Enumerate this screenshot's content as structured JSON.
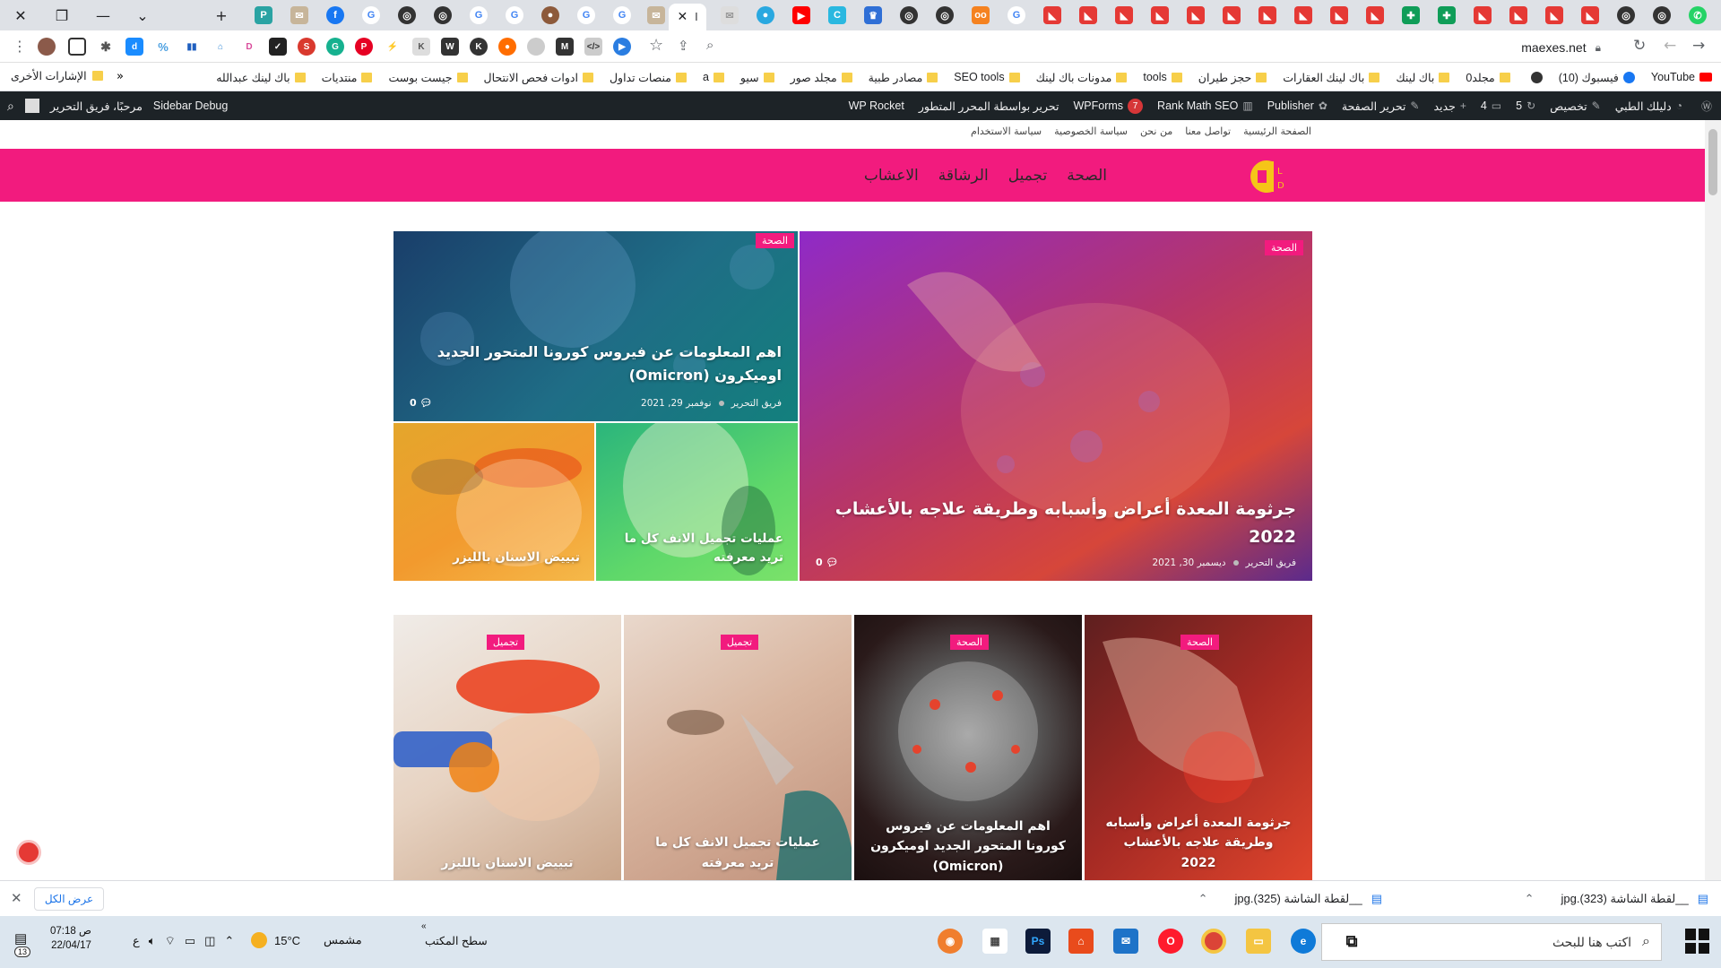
{
  "browser": {
    "address": "maexes.net",
    "active_tab_label": "ا",
    "bookmarks": [
      {
        "label": "YouTube",
        "icon": "youtube-icon"
      },
      {
        "label": "(10) فيسبوك",
        "icon": "facebook-icon"
      },
      {
        "label": "",
        "icon": "globe-icon"
      },
      {
        "label": "مجلد0",
        "icon": "folder-icon"
      },
      {
        "label": "باك لينك",
        "icon": "folder-icon"
      },
      {
        "label": "باك لينك العقارات",
        "icon": "folder-icon"
      },
      {
        "label": "حجز طيران",
        "icon": "folder-icon"
      },
      {
        "label": "tools",
        "icon": "folder-icon"
      },
      {
        "label": "مدونات باك لينك",
        "icon": "folder-icon"
      },
      {
        "label": "SEO tools",
        "icon": "folder-icon"
      },
      {
        "label": "مصادر طبية",
        "icon": "folder-icon"
      },
      {
        "label": "مجلد صور",
        "icon": "folder-icon"
      },
      {
        "label": "سيو",
        "icon": "folder-icon"
      },
      {
        "label": "a",
        "icon": "folder-icon"
      },
      {
        "label": "منصات تداول",
        "icon": "folder-icon"
      },
      {
        "label": "ادوات فحص الانتحال",
        "icon": "folder-icon"
      },
      {
        "label": "جيست بوست",
        "icon": "folder-icon"
      },
      {
        "label": "منتديات",
        "icon": "folder-icon"
      },
      {
        "label": "باك لينك عبدالله",
        "icon": "folder-icon"
      }
    ],
    "bookmarks_more": "»",
    "bookmarks_other": "الإشارات الأخرى"
  },
  "wpbar": {
    "right_items": [
      {
        "label": "",
        "icon": "wordpress-icon"
      },
      {
        "label": "دليلك الطبي",
        "icon": "dashboard-icon"
      },
      {
        "label": "تخصيص",
        "icon": "brush-icon"
      },
      {
        "label": "5",
        "icon": "refresh-icon"
      },
      {
        "label": "4",
        "icon": "comment-icon"
      },
      {
        "label": "جديد",
        "icon": "plus-icon"
      },
      {
        "label": "تحرير الصفحة",
        "icon": "pencil-icon"
      },
      {
        "label": "Publisher",
        "icon": "gear-icon"
      },
      {
        "label": "Rank Math SEO",
        "icon": "chart-icon"
      },
      {
        "label": "WPForms",
        "icon": "badge-icon"
      },
      {
        "label": "تحرير بواسطة المحرر المتطور",
        "icon": ""
      },
      {
        "label": "WP Rocket",
        "icon": ""
      }
    ],
    "wpforms_badge": "7",
    "left_items": [
      {
        "label": "Sidebar Debug"
      },
      {
        "label": "مرحبًا، فريق التحرير"
      }
    ]
  },
  "site": {
    "top_links": [
      "الصفحة الرئيسية",
      "تواصل معنا",
      "من نحن",
      "سياسة الخصوصية",
      "سياسة الاستخدام"
    ],
    "logo_text": "LD",
    "nav": [
      "الصحة",
      "تجميل",
      "الرشاقة",
      "الاعشاب"
    ],
    "featured": [
      {
        "category": "الصحة",
        "title": "جرثومة المعدة أعراض وأسبابه وطريقة علاجه بالأعشاب 2022",
        "author": "فريق التحرير",
        "date": "ديسمبر 30, 2021",
        "comments": "0"
      },
      {
        "category": "الصحة",
        "title": "اهم المعلومات عن فيروس كورونا المتحور الجديد اوميكرون (Omicron)",
        "author": "فريق التحرير",
        "date": "نوفمبر 29, 2021",
        "comments": "0"
      },
      {
        "category": "",
        "title": "عمليات تجميل الانف كل ما تريد معرفته",
        "author": "",
        "date": "",
        "comments": ""
      },
      {
        "category": "",
        "title": "تبييض الاسنان بالليزر",
        "author": "",
        "date": "",
        "comments": ""
      }
    ],
    "grid": [
      {
        "category": "الصحة",
        "title": "جرثومة المعدة أعراض وأسبابه وطريقة علاجه بالأعشاب 2022"
      },
      {
        "category": "الصحة",
        "title": "اهم المعلومات عن فيروس كورونا المتحور الجديد اوميكرون (Omicron)"
      },
      {
        "category": "تجميل",
        "title": "عمليات تجميل الانف كل ما تريد معرفته"
      },
      {
        "category": "تجميل",
        "title": "تبييض الاسنان بالليزر"
      }
    ]
  },
  "downloads": {
    "items": [
      {
        "file": "jpg.لقطة الشاشة (323)__"
      },
      {
        "file": "jpg.لقطة الشاشة (325)__"
      }
    ],
    "show_all": "عرض الكل"
  },
  "taskbar": {
    "search_placeholder": "اكتب هنا للبحث",
    "desktop_label": "سطح المكتب",
    "weather_temp": "15°C",
    "weather_label": "مشمس",
    "time": "07:18 ص",
    "date": "22/04/17",
    "lang": "ع",
    "notif_count": "13"
  },
  "colors": {
    "brand_pink": "#f21b7e",
    "wp_bar": "#1d2327",
    "taskbar": "#dce6ef"
  }
}
